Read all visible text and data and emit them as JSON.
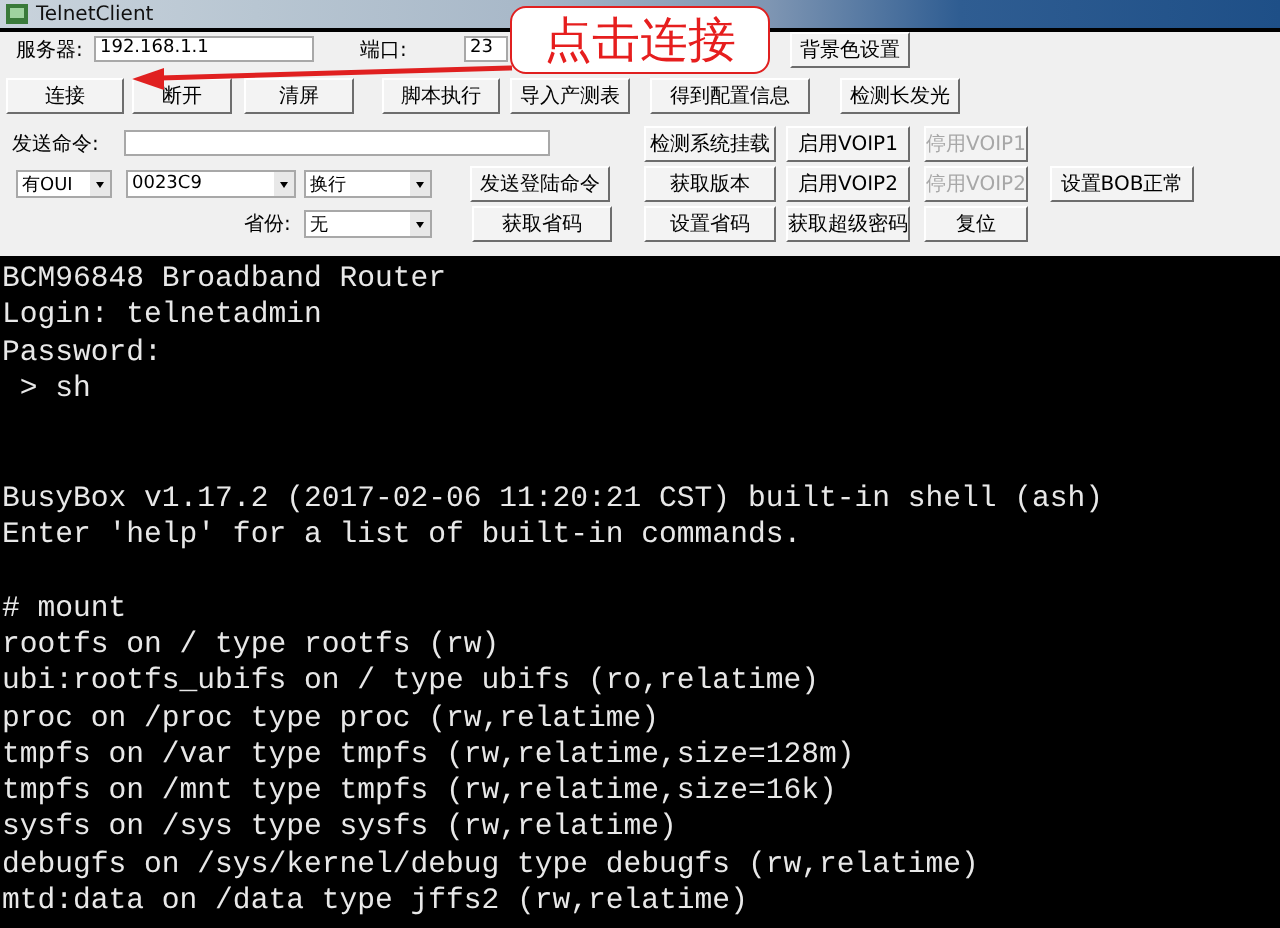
{
  "window": {
    "title": "TelnetClient"
  },
  "toolbar_rows": [
    {
      "items": [
        {
          "kind": "label",
          "text": "服务器:"
        },
        {
          "kind": "input",
          "value": "192.168.1.1"
        },
        {
          "kind": "label",
          "text": "端口:"
        },
        {
          "kind": "input",
          "value": "23"
        },
        {
          "kind": "button",
          "label": "背景色设置",
          "disabled": false
        }
      ]
    },
    {
      "items": [
        {
          "kind": "button",
          "label": "连接",
          "disabled": false
        },
        {
          "kind": "button",
          "label": "断开",
          "disabled": false
        },
        {
          "kind": "button",
          "label": "清屏",
          "disabled": false
        },
        {
          "kind": "button",
          "label": "脚本执行",
          "disabled": false
        },
        {
          "kind": "button",
          "label": "导入产测表",
          "disabled": false
        },
        {
          "kind": "button",
          "label": "得到配置信息",
          "disabled": false
        },
        {
          "kind": "button",
          "label": "检测长发光",
          "disabled": false
        }
      ]
    },
    {
      "items": [
        {
          "kind": "label",
          "text": "发送命令:"
        },
        {
          "kind": "input",
          "value": ""
        },
        {
          "kind": "button",
          "label": "检测系统挂载",
          "disabled": false
        },
        {
          "kind": "button",
          "label": "启用VOIP1",
          "disabled": false
        },
        {
          "kind": "button",
          "label": "停用VOIP1",
          "disabled": true
        }
      ]
    },
    {
      "items": [
        {
          "kind": "select",
          "value": "有OUI"
        },
        {
          "kind": "select",
          "value": "0023C9"
        },
        {
          "kind": "select",
          "value": "换行"
        },
        {
          "kind": "button",
          "label": "发送登陆命令",
          "disabled": false
        },
        {
          "kind": "button",
          "label": "获取版本",
          "disabled": false
        },
        {
          "kind": "button",
          "label": "启用VOIP2",
          "disabled": false
        },
        {
          "kind": "button",
          "label": "停用VOIP2",
          "disabled": true
        },
        {
          "kind": "button",
          "label": "设置BOB正常",
          "disabled": false
        }
      ]
    },
    {
      "items": [
        {
          "kind": "label",
          "text": "省份:"
        },
        {
          "kind": "select",
          "value": "无"
        },
        {
          "kind": "button",
          "label": "获取省码",
          "disabled": false
        },
        {
          "kind": "button",
          "label": "设置省码",
          "disabled": false
        },
        {
          "kind": "button",
          "label": "获取超级密码",
          "disabled": false
        },
        {
          "kind": "button",
          "label": "复位",
          "disabled": false
        }
      ]
    }
  ],
  "terminal": {
    "blocks": [
      {
        "lines": [
          "BCM96848 Broadband Router",
          "Login: telnetadmin",
          "Password:",
          " > sh"
        ]
      },
      {
        "lines": [
          "BusyBox v1.17.2 (2017-02-06 11:20:21 CST) built-in shell (ash)",
          "Enter 'help' for a list of built-in commands."
        ]
      },
      {
        "lines": [
          "# mount",
          "rootfs on / type rootfs (rw)",
          "ubi:rootfs_ubifs on / type ubifs (ro,relatime)",
          "proc on /proc type proc (rw,relatime)",
          "tmpfs on /var type tmpfs (rw,relatime,size=128m)",
          "tmpfs on /mnt type tmpfs (rw,relatime,size=16k)",
          "sysfs on /sys type sysfs (rw,relatime)",
          "debugfs on /sys/kernel/debug type debugfs (rw,relatime)",
          "mtd:data on /data type jffs2 (rw,relatime)"
        ]
      }
    ]
  },
  "annotation": {
    "text": "点击连接"
  }
}
